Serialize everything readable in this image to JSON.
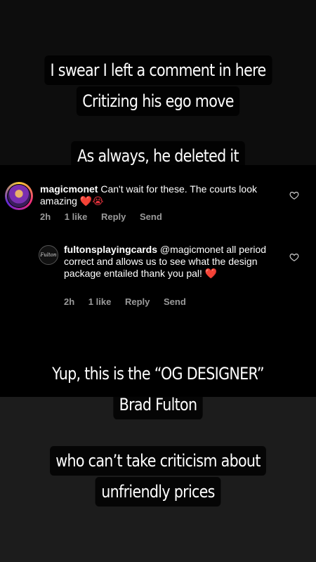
{
  "captions": {
    "top": [
      "I swear I left a comment in here",
      "Critizing his ego move"
    ],
    "deleted": "As always, he deleted it",
    "designer": [
      "Yup, this is the “OG DESIGNER”",
      "Brad Fulton"
    ],
    "criticism": [
      "who can’t take criticism about",
      "unfriendly prices"
    ]
  },
  "comments": [
    {
      "username": "magicmonet",
      "text": "Can't wait for these. The courts look amazing",
      "emoji": "❤️😭",
      "time": "2h",
      "likes": "1 like",
      "reply_label": "Reply",
      "send_label": "Send"
    },
    {
      "username": "fultonsplayingcards",
      "text": "@magicmonet all period correct and allows us to see what the design package entailed thank you pal!",
      "emoji": "❤️",
      "avatar_text": "Fulton",
      "time": "2h",
      "likes": "1 like",
      "reply_label": "Reply",
      "send_label": "Send"
    }
  ],
  "icons": {
    "like": "heart-outline-icon"
  },
  "colors": {
    "background": "#000000",
    "meta_text": "#9a9a9a",
    "heart_emoji": "#e0323c"
  }
}
